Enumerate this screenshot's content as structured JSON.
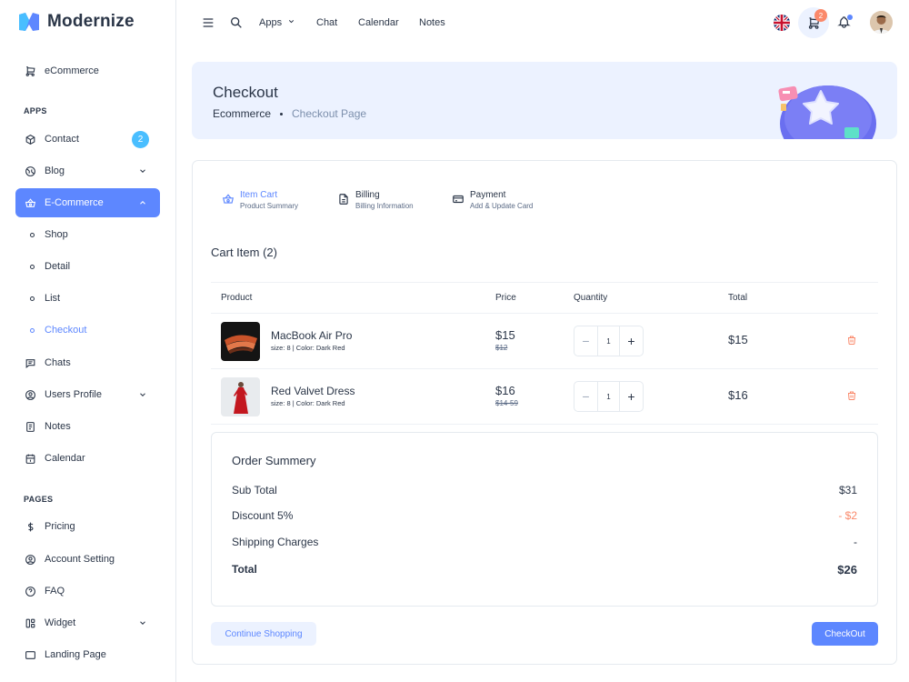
{
  "brand": {
    "name": "Modernize",
    "accent": "#5d87ff"
  },
  "sidebar": {
    "top_item": {
      "label": "eCommerce",
      "icon": "cart-icon"
    },
    "apps_section": "APPS",
    "items": [
      {
        "label": "Contact",
        "icon": "box-icon",
        "badge": "2"
      },
      {
        "label": "Blog",
        "icon": "globe-icon"
      },
      {
        "label": "E-Commerce",
        "icon": "basket-icon"
      }
    ],
    "ecommerce_sub": [
      "Shop",
      "Detail",
      "List",
      "Checkout"
    ],
    "items2": [
      {
        "label": "Chats",
        "icon": "message-icon"
      },
      {
        "label": "Users Profile",
        "icon": "user-circle-icon"
      },
      {
        "label": "Notes",
        "icon": "notes-icon"
      },
      {
        "label": "Calendar",
        "icon": "calendar-icon"
      }
    ],
    "pages_section": "PAGES",
    "pages": [
      {
        "label": "Pricing",
        "icon": "dollar-icon"
      },
      {
        "label": "Account Setting",
        "icon": "account-icon"
      },
      {
        "label": "FAQ",
        "icon": "help-icon"
      },
      {
        "label": "Widget",
        "icon": "widget-icon"
      },
      {
        "label": "Landing Page",
        "icon": "app-window-icon"
      }
    ]
  },
  "topbar": {
    "links": [
      "Apps",
      "Chat",
      "Calendar",
      "Notes"
    ],
    "cart_count": "2"
  },
  "banner": {
    "title": "Checkout",
    "crumb_home": "Ecommerce",
    "crumb_current": "Checkout Page"
  },
  "steps": [
    {
      "title": "Item Cart",
      "subtitle": "Product Summary"
    },
    {
      "title": "Billing",
      "subtitle": "Billing Information"
    },
    {
      "title": "Payment",
      "subtitle": "Add & Update Card"
    }
  ],
  "cart": {
    "title": "Cart Item (2)",
    "headers": [
      "Product",
      "Price",
      "Quantity",
      "Total"
    ],
    "rows": [
      {
        "name": "MacBook Air Pro",
        "meta": "size: 8 | Color: Dark Red",
        "price": "$15",
        "old_price": "$12",
        "qty": "1",
        "total": "$15"
      },
      {
        "name": "Red Valvet Dress",
        "meta": "size: 8 | Color: Dark Red",
        "price": "$16",
        "old_price": "$14-59",
        "qty": "1",
        "total": "$16"
      }
    ]
  },
  "summary": {
    "title": "Order Summery",
    "subtotal_label": "Sub Total",
    "subtotal": "$31",
    "discount_label": "Discount 5%",
    "discount": "- $2",
    "shipping_label": "Shipping Charges",
    "shipping": "-",
    "total_label": "Total",
    "total": "$26"
  },
  "buttons": {
    "continue": "Continue Shopping",
    "checkout": "CheckOut"
  }
}
